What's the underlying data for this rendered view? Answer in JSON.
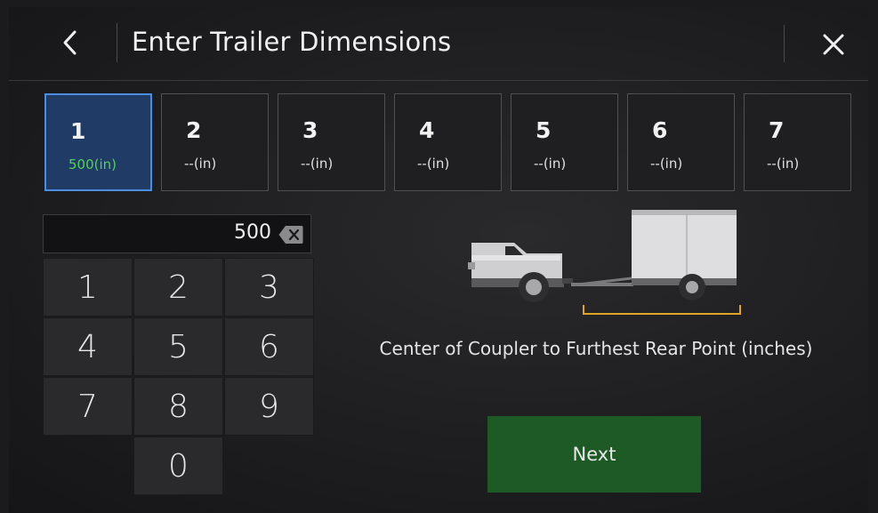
{
  "header": {
    "title": "Enter Trailer Dimensions",
    "back_icon": "chevron-left-icon",
    "close_icon": "close-icon"
  },
  "tabs": [
    {
      "num": "1",
      "value": "500(in)",
      "active": true
    },
    {
      "num": "2",
      "value": "--(in)",
      "active": false
    },
    {
      "num": "3",
      "value": "--(in)",
      "active": false
    },
    {
      "num": "4",
      "value": "--(in)",
      "active": false
    },
    {
      "num": "5",
      "value": "--(in)",
      "active": false
    },
    {
      "num": "6",
      "value": "--(in)",
      "active": false
    },
    {
      "num": "7",
      "value": "--(in)",
      "active": false
    }
  ],
  "entry": {
    "value": "500",
    "backspace_icon": "backspace-icon"
  },
  "keypad": {
    "keys": [
      "1",
      "2",
      "3",
      "4",
      "5",
      "6",
      "7",
      "8",
      "9",
      "0"
    ]
  },
  "illustration": {
    "description": "Center of Coupler to Furthest Rear Point (inches)"
  },
  "actions": {
    "next_label": "Next"
  },
  "colors": {
    "active_tab_bg": "#1f3b66",
    "active_tab_border": "#4d8de0",
    "active_value": "#55d05a",
    "next_button": "#1d5a25",
    "measure_bracket": "#e0a526"
  }
}
